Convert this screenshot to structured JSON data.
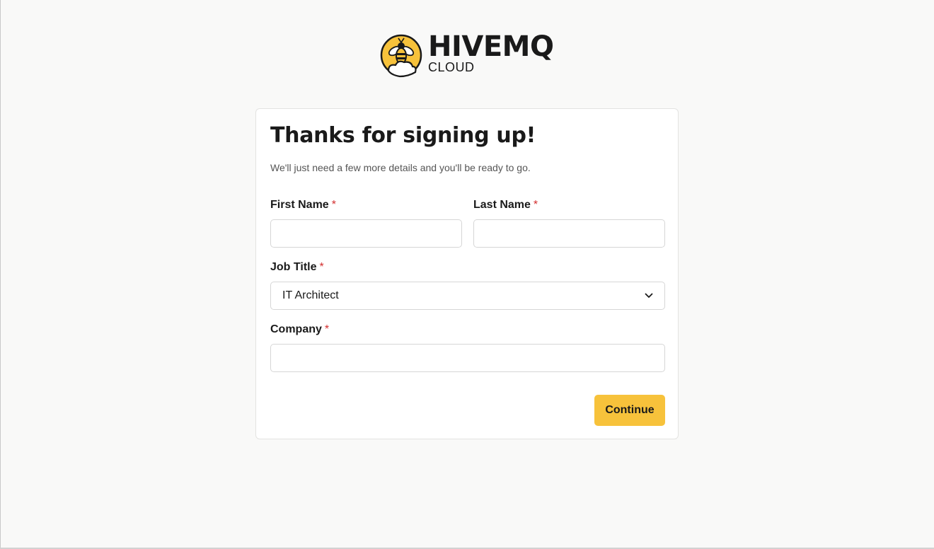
{
  "brand": {
    "name": "HIVEMQ",
    "sub": "CLOUD",
    "accent": "#f7c23b"
  },
  "form": {
    "title": "Thanks for signing up!",
    "subtitle": "We'll just need a few more details and you'll be ready to go.",
    "required_marker": "*",
    "first_name": {
      "label": "First Name",
      "value": "",
      "placeholder": ""
    },
    "last_name": {
      "label": "Last Name",
      "value": "",
      "placeholder": ""
    },
    "job_title": {
      "label": "Job Title",
      "selected": "IT Architect",
      "icon": "chevron-down-icon"
    },
    "company": {
      "label": "Company",
      "value": "",
      "placeholder": ""
    },
    "submit_label": "Continue"
  },
  "colors": {
    "required": "#d32f2f",
    "button": "#f7c23b",
    "background": "#f9f9f8"
  }
}
